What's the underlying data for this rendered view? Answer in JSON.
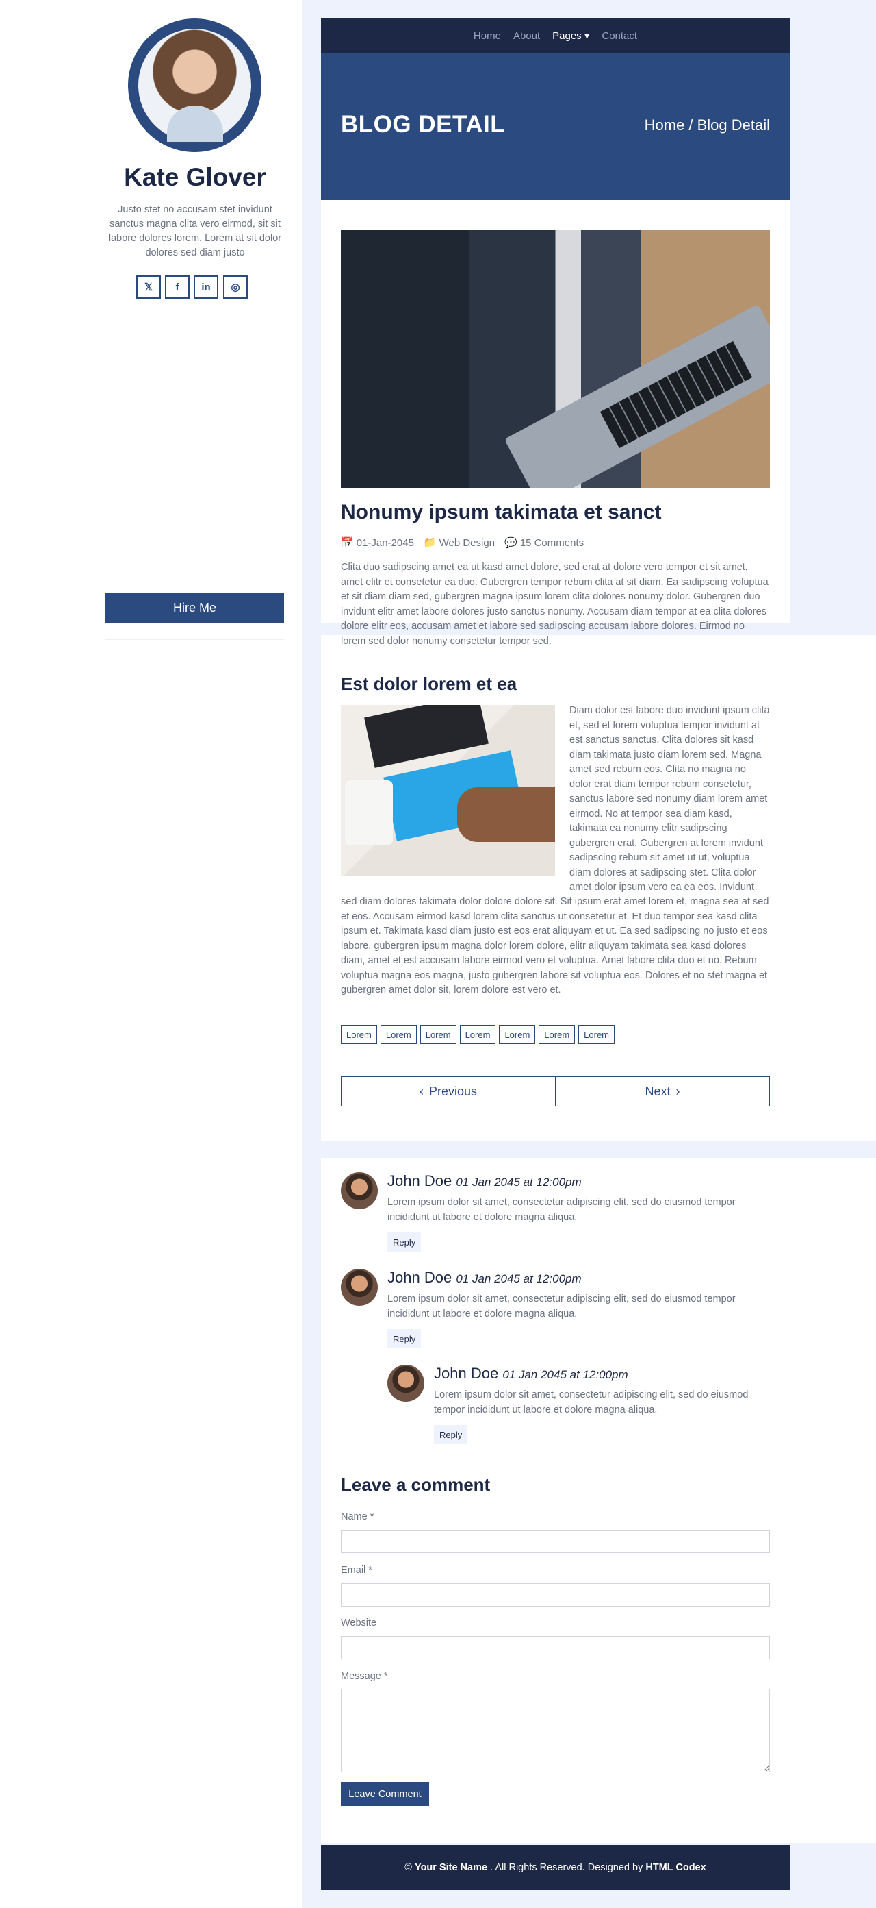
{
  "sidebar": {
    "name": "Kate Glover",
    "bio": "Justo stet no accusam stet invidunt sanctus magna clita vero eirmod, sit sit labore dolores lorem. Lorem at sit dolor dolores sed diam justo",
    "social": [
      {
        "icon": "twitter-icon",
        "glyph": "𝕏"
      },
      {
        "icon": "facebook-icon",
        "glyph": "f"
      },
      {
        "icon": "linkedin-icon",
        "glyph": "in"
      },
      {
        "icon": "instagram-icon",
        "glyph": "◎"
      }
    ],
    "hire_label": "Hire Me"
  },
  "nav": {
    "items": [
      "Home",
      "About",
      "Pages ▾",
      "Contact"
    ],
    "active": "Pages"
  },
  "hero": {
    "title": "BLOG DETAIL",
    "breadcrumb": "Home / Blog Detail"
  },
  "post": {
    "title": "Nonumy ipsum takimata et sanct",
    "date": "01-Jan-2045",
    "category": "Web Design",
    "comments": "15 Comments",
    "intro": "Clita duo sadipscing amet ea ut kasd amet dolore, sed erat at dolore vero tempor et sit amet, amet elitr et consetetur ea duo. Gubergren tempor rebum clita at sit diam. Ea sadipscing voluptua et sit diam diam sed, gubergren magna ipsum lorem clita dolores nonumy dolor. Gubergren duo invidunt elitr amet labore dolores justo sanctus nonumy. Accusam diam tempor at ea clita dolores dolore elitr eos, accusam amet et labore sed sadipscing accusam labore dolores. Eirmod no lorem sed dolor nonumy consetetur tempor sed.",
    "subtitle": "Est dolor lorem et ea",
    "wrap_text": "Diam dolor est labore duo invidunt ipsum clita et, sed et lorem voluptua tempor invidunt at est sanctus sanctus. Clita dolores sit kasd diam takimata justo diam lorem sed. Magna amet sed rebum eos. Clita no magna no dolor erat diam tempor rebum consetetur, sanctus labore sed nonumy diam lorem amet eirmod. No at tempor sea diam kasd, takimata ea nonumy elitr sadipscing gubergren erat. Gubergren at lorem invidunt sadipscing rebum sit amet ut ut, voluptua diam dolores at sadipscing stet. Clita dolor amet dolor ipsum vero ea ea eos. Invidunt",
    "wrap_after": "sed diam dolores takimata dolor dolore dolore sit. Sit ipsum erat amet lorem et, magna sea at sed et eos. Accusam eirmod kasd lorem clita sanctus ut consetetur et. Et duo tempor sea kasd clita ipsum et. Takimata kasd diam justo est eos erat aliquyam et ut. Ea sed sadipscing no justo et eos labore, gubergren ipsum magna dolor lorem dolore, elitr aliquyam takimata sea kasd dolores diam, amet et est accusam labore eirmod vero et voluptua. Amet labore clita duo et no. Rebum voluptua magna eos magna, justo gubergren labore sit voluptua eos. Dolores et no stet magna et gubergren amet dolor sit, lorem dolore est vero et.",
    "tags": [
      "Lorem",
      "Lorem",
      "Lorem",
      "Lorem",
      "Lorem",
      "Lorem",
      "Lorem"
    ],
    "prev_label": "Previous",
    "next_label": "Next"
  },
  "comments": [
    {
      "name": "John Doe",
      "date": "01 Jan 2045 at 12:00pm",
      "text": "Lorem ipsum dolor sit amet, consectetur adipiscing elit, sed do eiusmod tempor incididunt ut labore et dolore magna aliqua.",
      "reply": "Reply"
    },
    {
      "name": "John Doe",
      "date": "01 Jan 2045 at 12:00pm",
      "text": "Lorem ipsum dolor sit amet, consectetur adipiscing elit, sed do eiusmod tempor incididunt ut labore et dolore magna aliqua.",
      "reply": "Reply"
    },
    {
      "name": "John Doe",
      "date": "01 Jan 2045 at 12:00pm",
      "text": "Lorem ipsum dolor sit amet, consectetur adipiscing elit, sed do eiusmod tempor incididunt ut labore et dolore magna aliqua.",
      "reply": "Reply"
    }
  ],
  "form": {
    "title": "Leave a comment",
    "name_label": "Name *",
    "email_label": "Email *",
    "website_label": "Website",
    "message_label": "Message *",
    "submit_label": "Leave Comment"
  },
  "footer": {
    "prefix": "©",
    "site": "Your Site Name",
    "middle": ". All Rights Reserved. Designed by",
    "author": "HTML Codex"
  },
  "colors": {
    "navy": "#1d2846",
    "blue": "#2b4a80",
    "page_bg": "#eef2fc"
  }
}
